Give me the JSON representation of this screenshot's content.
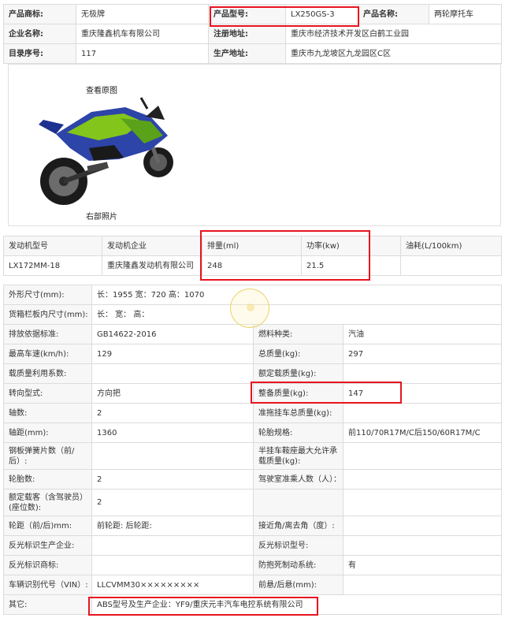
{
  "top": {
    "brand_label": "产品商标:",
    "brand_value": "无极牌",
    "model_label": "产品型号:",
    "model_value": "LX250GS-3",
    "name_label": "产品名称:",
    "name_value": "两轮摩托车",
    "company_label": "企业名称:",
    "company_value": "重庆隆鑫机车有限公司",
    "reg_addr_label": "注册地址:",
    "reg_addr_value": "重庆市经济技术开发区白鹤工业园",
    "catalog_label": "目录序号:",
    "catalog_value": "117",
    "prod_addr_label": "生产地址:",
    "prod_addr_value": "重庆市九龙坡区九龙园区C区"
  },
  "photo": {
    "view_original": "查看原图",
    "caption": "右部照片"
  },
  "engine": {
    "headers": [
      "发动机型号",
      "发动机企业",
      "排量(ml)",
      "功率(kw)",
      "油耗(L/100km)"
    ],
    "row": [
      "LX172MM-18",
      "重庆隆鑫发动机有限公司",
      "248",
      "21.5",
      ""
    ]
  },
  "specs": {
    "dims_label": "外形尺寸(mm):",
    "dims_value": "长：1955 宽：720 高：1070",
    "cargo_label": "货箱栏板内尺寸(mm):",
    "cargo_value": "长：  宽：  高：",
    "rows": [
      {
        "l1": "排放依据标准:",
        "v1": "GB14622-2016",
        "l2": "燃料种类:",
        "v2": "汽油"
      },
      {
        "l1": "最高车速(km/h):",
        "v1": "129",
        "l2": "总质量(kg):",
        "v2": "297"
      },
      {
        "l1": "载质量利用系数:",
        "v1": "",
        "l2": "额定载质量(kg):",
        "v2": ""
      },
      {
        "l1": "转向型式:",
        "v1": "方向把",
        "l2": "整备质量(kg):",
        "v2": "147"
      },
      {
        "l1": "轴数:",
        "v1": "2",
        "l2": "准拖挂车总质量(kg):",
        "v2": ""
      },
      {
        "l1": "轴距(mm):",
        "v1": "1360",
        "l2": "轮胎规格:",
        "v2": "前110/70R17M/C后150/60R17M/C"
      },
      {
        "l1": "钢板弹簧片数（前/后）:",
        "v1": "",
        "l2": "半挂车鞍座最大允许承载质量(kg):",
        "v2": ""
      },
      {
        "l1": "轮胎数:",
        "v1": "2",
        "l2": "驾驶室准乘人数（人）：",
        "v2": ""
      },
      {
        "l1": "额定载客（含驾驶员）(座位数):",
        "v1": "2",
        "l2": "",
        "v2": ""
      },
      {
        "l1": "轮距（前/后)mm:",
        "v1": "前轮距: 后轮距:",
        "l2": "接近角/离去角（度）:",
        "v2": ""
      },
      {
        "l1": "反光标识生产企业:",
        "v1": "",
        "l2": "反光标识型号:",
        "v2": ""
      },
      {
        "l1": "反光标识商标:",
        "v1": "",
        "l2": "防抱死制动系统:",
        "v2": "有"
      },
      {
        "l1": "车辆识别代号（VIN）:",
        "v1": "LLCVMM30×××××××××",
        "l2": "前悬/后悬(mm):",
        "v2": ""
      }
    ],
    "other_label": "其它:",
    "other_value": "ABS型号及生产企业：YF9/重庆元丰汽车电控系统有限公司"
  }
}
